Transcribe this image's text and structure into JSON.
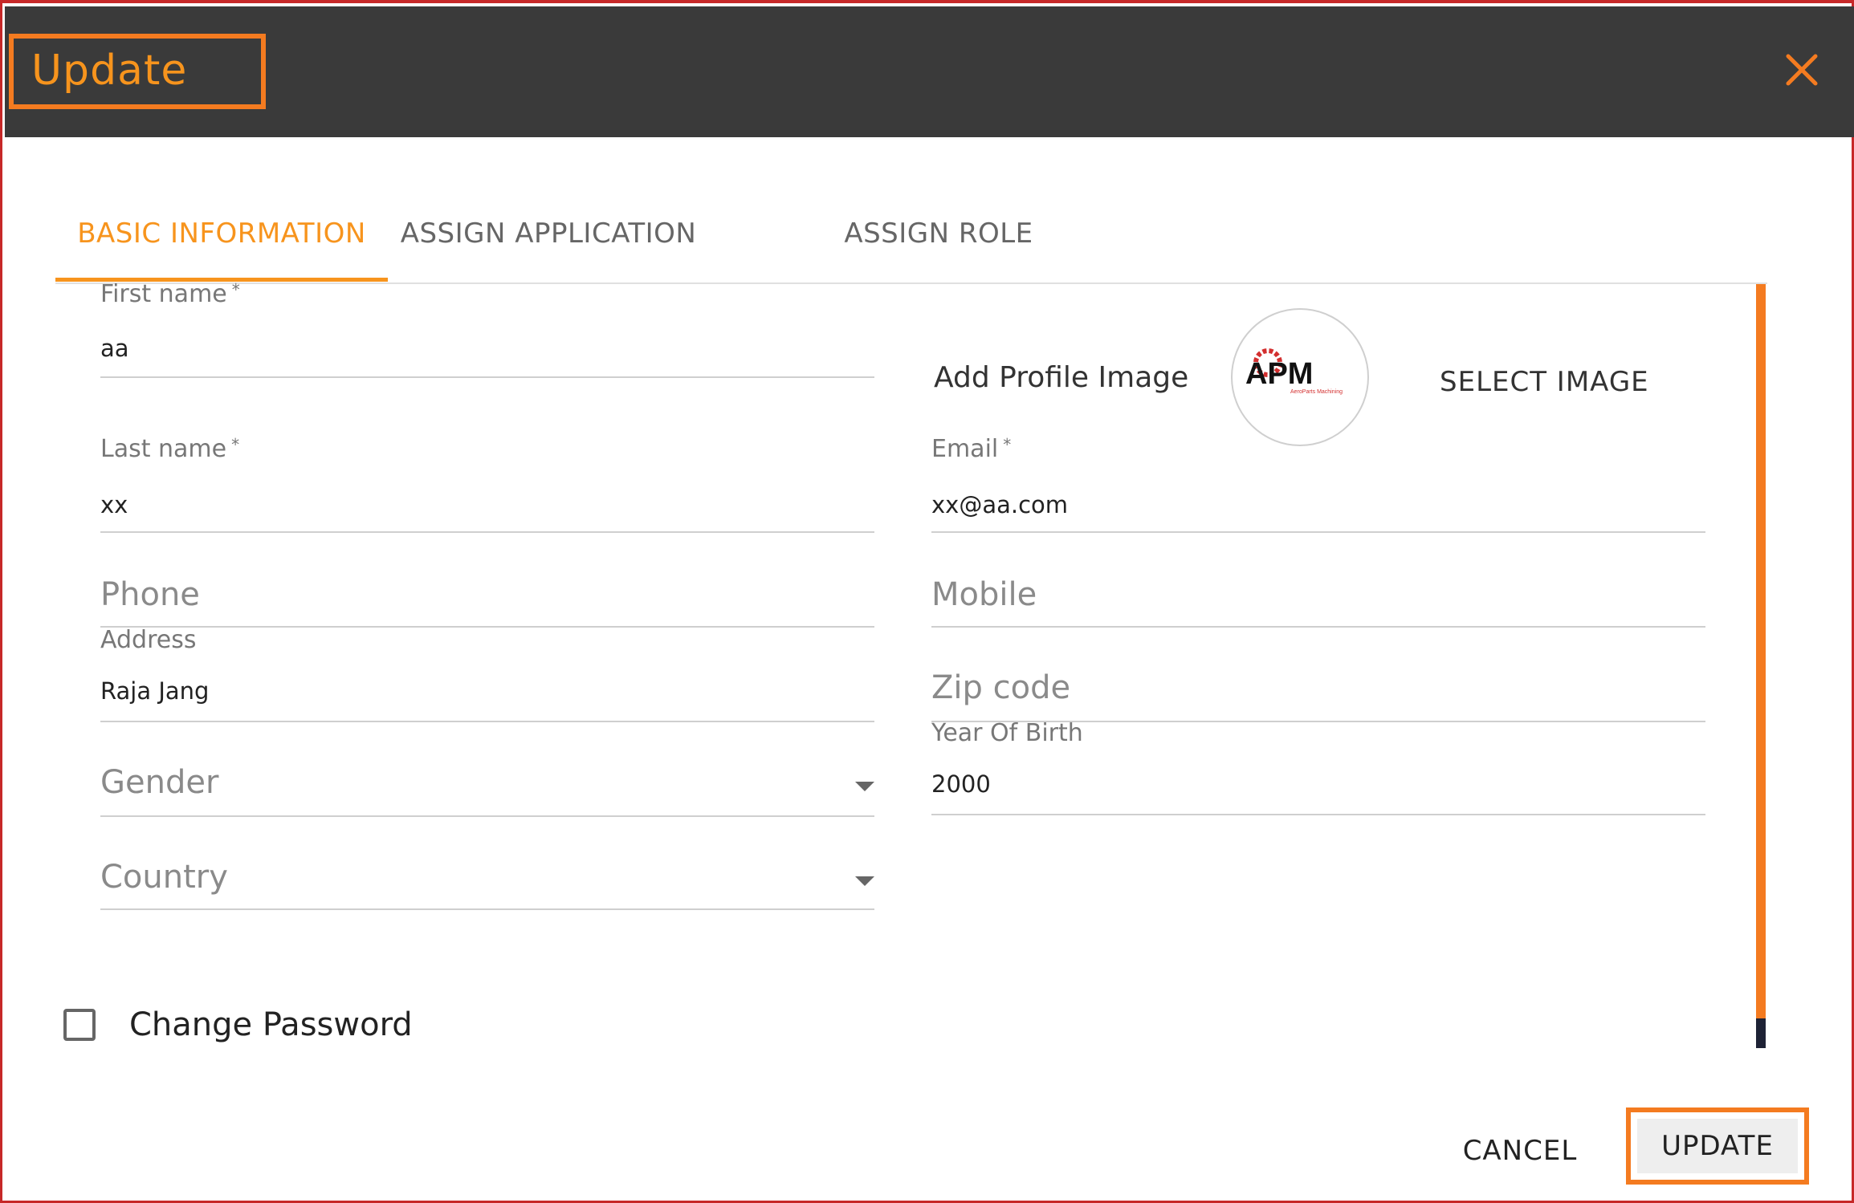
{
  "dialog": {
    "title": "Update",
    "close_icon": "close-icon",
    "accent_color": "#f7941d",
    "header_color": "#3a3a3a"
  },
  "tabs": [
    {
      "label": "BASIC INFORMATION",
      "active": true
    },
    {
      "label": "ASSIGN APPLICATION",
      "active": false
    },
    {
      "label": "ASSIGN ROLE",
      "active": false
    }
  ],
  "form": {
    "first_name": {
      "label": "First name",
      "required": "*",
      "value": "aa"
    },
    "last_name": {
      "label": "Last name",
      "required": "*",
      "value": "xx"
    },
    "phone": {
      "placeholder": "Phone"
    },
    "address": {
      "label": "Address",
      "value": "Raja Jang"
    },
    "gender": {
      "placeholder": "Gender"
    },
    "country": {
      "placeholder": "Country"
    },
    "profile_image": {
      "label": "Add Profile Image",
      "select_label": "SELECT IMAGE",
      "logo_text": "APM",
      "logo_subtext": "AeroParts Machining"
    },
    "email": {
      "label": "Email",
      "required": "*",
      "value": "xx@aa.com"
    },
    "mobile": {
      "placeholder": "Mobile"
    },
    "zip_code": {
      "placeholder": "Zip code"
    },
    "year_of_birth": {
      "label": "Year Of Birth",
      "value": "2000"
    },
    "change_password": {
      "label": "Change Password",
      "checked": false
    }
  },
  "footer": {
    "cancel_label": "CANCEL",
    "update_label": "UPDATE"
  }
}
